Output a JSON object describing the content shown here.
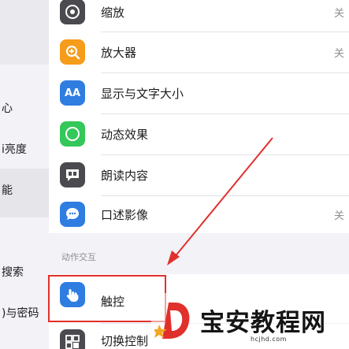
{
  "sidebar": {
    "items": [
      {
        "label": "心"
      },
      {
        "label": "i亮度"
      },
      {
        "label": "能"
      },
      {
        "label": "搜索"
      },
      {
        "label": ")与密码"
      }
    ]
  },
  "settings": {
    "rows": [
      {
        "label": "缩放",
        "value": "关",
        "icon": "zoom-icon",
        "color": "#4a4a4f"
      },
      {
        "label": "放大器",
        "value": "关",
        "icon": "magnifier-icon",
        "color": "#f59c1a"
      },
      {
        "label": "显示与文字大小",
        "value": "",
        "icon": "display-text-size-icon",
        "color": "#2f7de1",
        "glyph": "AA"
      },
      {
        "label": "动态效果",
        "value": "",
        "icon": "motion-icon",
        "color": "#34c759"
      },
      {
        "label": "朗读内容",
        "value": "",
        "icon": "spoken-content-icon",
        "color": "#4a4a4f"
      },
      {
        "label": "口述影像",
        "value": "关",
        "icon": "audio-description-icon",
        "color": "#2f7de1"
      }
    ],
    "section_header": "动作交互",
    "interaction_rows": [
      {
        "label": "触控",
        "icon": "touch-icon",
        "color": "#2f7de1"
      },
      {
        "label": "切换控制",
        "icon": "switch-control-icon",
        "color": "#4a4a4f"
      }
    ]
  },
  "watermark": {
    "text": "宝安教程网",
    "url": "hcjhd.com"
  },
  "colors": {
    "annotation": "#e0302c"
  }
}
